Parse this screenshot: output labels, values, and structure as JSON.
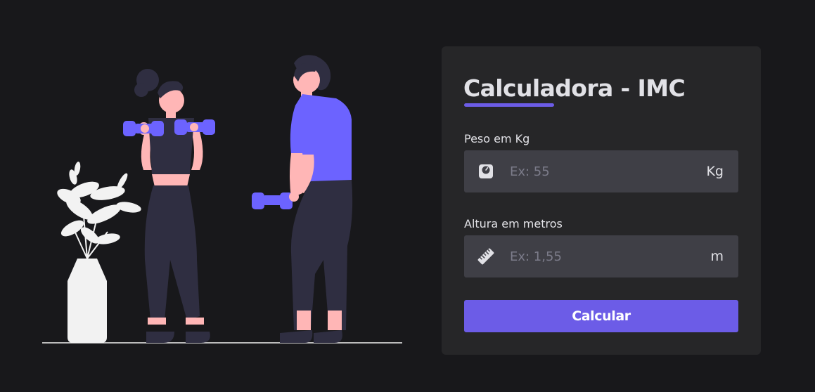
{
  "card": {
    "title": "Calculadora - IMC"
  },
  "weight": {
    "label": "Peso em Kg",
    "placeholder": "Ex: 55",
    "value": "",
    "unit": "Kg",
    "icon": "scale-icon"
  },
  "height": {
    "label": "Altura em metros",
    "placeholder": "Ex: 1,55",
    "value": "",
    "unit": "m",
    "icon": "ruler-icon"
  },
  "button": {
    "label": "Calcular"
  },
  "colors": {
    "background": "#18181b",
    "card": "#262628",
    "input": "#3f3f46",
    "accent": "#6c5ce7",
    "text": "#e1e1e6",
    "placeholder": "#7c7c8a"
  }
}
